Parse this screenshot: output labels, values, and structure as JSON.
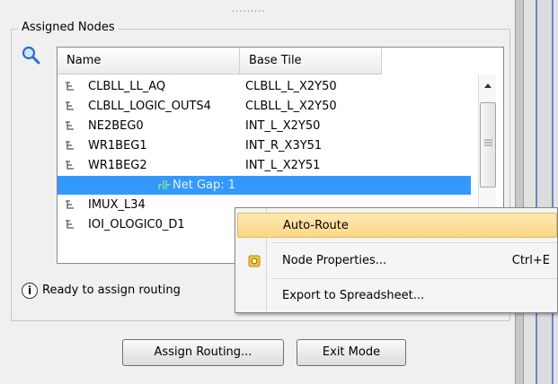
{
  "group": {
    "title": "Assigned Nodes",
    "grip": "........."
  },
  "table": {
    "columns": [
      "Name",
      "Base Tile"
    ],
    "rows": [
      {
        "name": "CLBLL_LL_AQ",
        "tile": "CLBLL_L_X2Y50"
      },
      {
        "name": "CLBLL_LOGIC_OUTS4",
        "tile": "CLBLL_L_X2Y50"
      },
      {
        "name": "NE2BEG0",
        "tile": "INT_L_X2Y50"
      },
      {
        "name": "WR1BEG1",
        "tile": "INT_R_X3Y51"
      },
      {
        "name": "WR1BEG2",
        "tile": "INT_L_X2Y51"
      },
      {
        "gap": "Net Gap: 1"
      },
      {
        "name": "IMUX_L34",
        "tile": ""
      },
      {
        "name": "IOI_OLOGIC0_D1",
        "tile": ""
      }
    ]
  },
  "status": {
    "icon": "i",
    "text": "Ready to assign routing"
  },
  "buttons": {
    "assign": "Assign Routing...",
    "exit": "Exit Mode"
  },
  "context_menu": {
    "items": [
      {
        "label": "Auto-Route",
        "shortcut": ""
      },
      {
        "label": "Node Properties...",
        "shortcut": "Ctrl+E"
      },
      {
        "label": "Export to Spreadsheet...",
        "shortcut": ""
      }
    ]
  },
  "colors": {
    "selection": "#3399ff",
    "menu_highlight": "#fbd786",
    "accent_strip": "#6c87ba"
  }
}
